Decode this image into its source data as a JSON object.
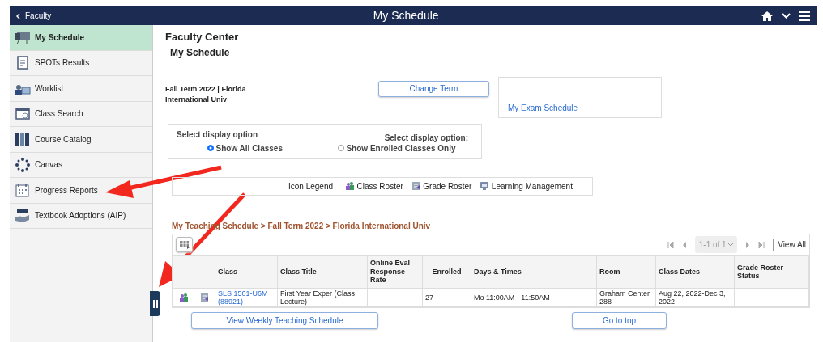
{
  "header": {
    "back_label": "Faculty",
    "title": "My Schedule"
  },
  "sidebar": {
    "items": [
      {
        "label": "My Schedule",
        "selected": true
      },
      {
        "label": "SPOTs Results",
        "selected": false
      },
      {
        "label": "Worklist",
        "selected": false
      },
      {
        "label": "Class Search",
        "selected": false
      },
      {
        "label": "Course Catalog",
        "selected": false
      },
      {
        "label": "Canvas",
        "selected": false
      },
      {
        "label": "Progress Reports",
        "selected": false
      },
      {
        "label": "Textbook Adoptions (AIP)",
        "selected": false
      }
    ]
  },
  "page": {
    "heading": "Faculty Center",
    "subheading": "My Schedule",
    "term": "Fall Term 2022 | Florida International Univ",
    "change_term": "Change Term",
    "exam_link": "My Exam Schedule"
  },
  "display_options": {
    "label_left": "Select display option",
    "label_right": "Select display option:",
    "options": [
      {
        "label": "Show All Classes",
        "selected": true
      },
      {
        "label": "Show Enrolled Classes Only",
        "selected": false
      }
    ]
  },
  "legend": {
    "title": "Icon Legend",
    "items": [
      "Class Roster",
      "Grade Roster",
      "Learning Management"
    ]
  },
  "schedule": {
    "breadcrumb": "My Teaching Schedule > Fall Term 2022 > Florida International Univ",
    "pager": "1-1 of 1",
    "view_all": "View All",
    "columns": [
      "Class",
      "Class Title",
      "Online Eval Response Rate",
      "Enrolled",
      "Days & Times",
      "Room",
      "Class Dates",
      "Grade Roster Status"
    ],
    "rows": [
      {
        "class": "SLS 1501-U6M (88921)",
        "title": "First Year Exper (Class Lecture)",
        "eval": "",
        "enrolled": "27",
        "days": "Mo 11:00AM - 11:50AM",
        "room": "Graham Center 288",
        "dates": "Aug 22, 2022-Dec 3, 2022",
        "status": ""
      }
    ]
  },
  "buttons": {
    "weekly": "View Weekly Teaching Schedule",
    "top": "Go to top"
  }
}
